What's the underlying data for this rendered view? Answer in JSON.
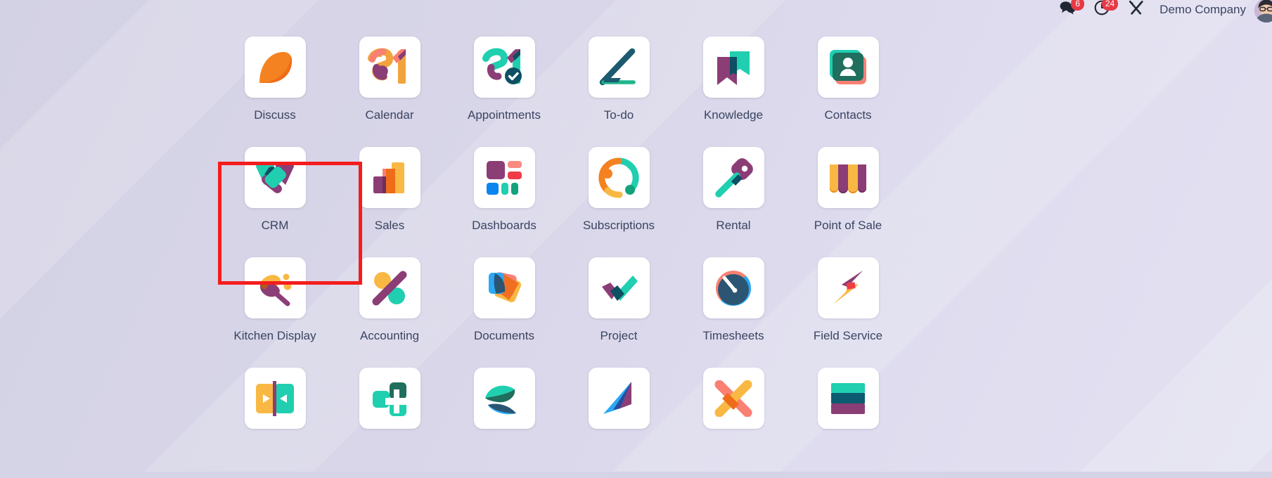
{
  "topbar": {
    "messages": {
      "icon": "chat-bubbles-icon",
      "badge": "6"
    },
    "activities": {
      "icon": "clock-icon",
      "badge": "24"
    },
    "settings": {
      "icon": "tools-icon"
    },
    "company": "Demo Company",
    "avatar": {
      "icon": "user-avatar"
    }
  },
  "highlight": {
    "target": "CRM",
    "color": "#f41d1d"
  },
  "apps": [
    {
      "label": "Discuss",
      "icon": "discuss-icon"
    },
    {
      "label": "Calendar",
      "icon": "calendar-icon"
    },
    {
      "label": "Appointments",
      "icon": "appointments-icon"
    },
    {
      "label": "To-do",
      "icon": "todo-icon"
    },
    {
      "label": "Knowledge",
      "icon": "knowledge-icon"
    },
    {
      "label": "Contacts",
      "icon": "contacts-icon"
    },
    {
      "label": "CRM",
      "icon": "crm-icon"
    },
    {
      "label": "Sales",
      "icon": "sales-icon"
    },
    {
      "label": "Dashboards",
      "icon": "dashboards-icon"
    },
    {
      "label": "Subscriptions",
      "icon": "subscriptions-icon"
    },
    {
      "label": "Rental",
      "icon": "rental-icon"
    },
    {
      "label": "Point of Sale",
      "icon": "point-of-sale-icon"
    },
    {
      "label": "Kitchen Display",
      "icon": "kitchen-display-icon"
    },
    {
      "label": "Accounting",
      "icon": "accounting-icon"
    },
    {
      "label": "Documents",
      "icon": "documents-icon"
    },
    {
      "label": "Project",
      "icon": "project-icon"
    },
    {
      "label": "Timesheets",
      "icon": "timesheets-icon"
    },
    {
      "label": "Field Service",
      "icon": "field-service-icon"
    },
    {
      "label": "",
      "icon": "slides-icon"
    },
    {
      "label": "",
      "icon": "helpdesk-icon"
    },
    {
      "label": "",
      "icon": "elearning-icon"
    },
    {
      "label": "",
      "icon": "marketing-icon"
    },
    {
      "label": "",
      "icon": "expenses-icon"
    },
    {
      "label": "",
      "icon": "stacked-bars-icon"
    }
  ]
}
